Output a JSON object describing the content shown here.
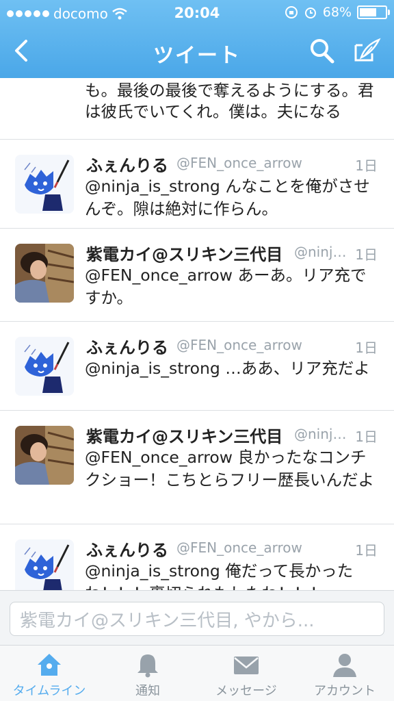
{
  "status": {
    "carrier": "docomo",
    "time": "20:04",
    "battery_level": "68%",
    "battery_fraction": 0.68
  },
  "nav": {
    "title": "ツイート"
  },
  "partial_tweet": {
    "text": "も。最後の最後で奪えるようにする。君は彼氏でいてくれ。僕は。夫になる"
  },
  "tweets": [
    {
      "name": "ふぇんりる",
      "handle": "@FEN_once_arrow",
      "time": "1日",
      "text": "@ninja_is_strong んなことを俺がさせんぞ。隙は絶対に作らん。"
    },
    {
      "name": "紫電カイ@スリキン三代目",
      "handle": "@ninj…",
      "time": "1日",
      "text": "@FEN_once_arrow あーあ。リア充ですか。"
    },
    {
      "name": "ふぇんりる",
      "handle": "@FEN_once_arrow",
      "time": "1日",
      "text": "@ninja_is_strong …ああ、リア充だよ"
    },
    {
      "name": "紫電カイ@スリキン三代目",
      "handle": "@ninj…",
      "time": "1日",
      "text": "@FEN_once_arrow 良かったなコンチクショー！こちとらフリー歴長いんだよ"
    },
    {
      "name": "ふぇんりる",
      "handle": "@FEN_once_arrow",
      "time": "1日",
      "text": "@ninja_is_strong 俺だって長かったわ！！！裏切られもしたわ！！！"
    }
  ],
  "reply": {
    "placeholder": "紫電カイ@スリキン三代目, やから..."
  },
  "tabs": [
    {
      "label": "タイムライン",
      "icon": "home-icon"
    },
    {
      "label": "通知",
      "icon": "bell-icon"
    },
    {
      "label": "メッセージ",
      "icon": "envelope-icon"
    },
    {
      "label": "アカウント",
      "icon": "person-icon"
    }
  ],
  "colors": {
    "header": "#4aa7e8",
    "accent": "#55acee",
    "muted": "#9aa3ab"
  }
}
